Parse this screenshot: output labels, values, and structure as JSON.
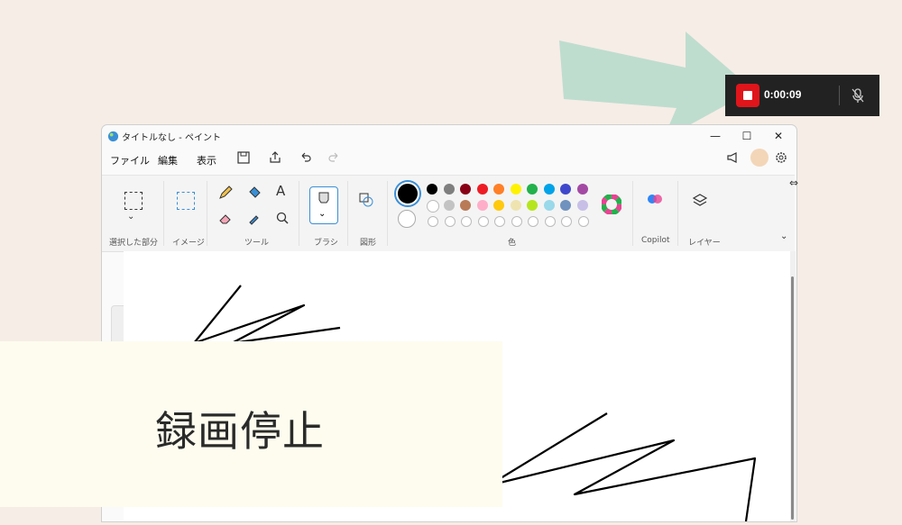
{
  "window": {
    "title": "タイトルなし - ペイント",
    "controls": {
      "minimize": "—",
      "maximize": "☐",
      "close": "✕"
    }
  },
  "menu": {
    "file": "ファイル",
    "edit": "編集",
    "view": "表示"
  },
  "ribbon": {
    "groups": {
      "selection": "選択した部分",
      "image": "イメージ",
      "tools": "ツール",
      "brush": "ブラシ",
      "shapes": "図形",
      "colors": "色",
      "copilot": "Copilot",
      "layers": "レイヤー"
    },
    "palette_row1": [
      "#000000",
      "#7f7f7f",
      "#880015",
      "#ed1c24",
      "#ff7f27",
      "#fff200",
      "#22b14c",
      "#00a2e8",
      "#3f48cc",
      "#a349a4"
    ],
    "palette_row2": [
      "#ffffff",
      "#c3c3c3",
      "#b97a57",
      "#ffaec9",
      "#ffc90e",
      "#efe4b0",
      "#b5e61d",
      "#99d9ea",
      "#7092be",
      "#c8bfe7"
    ]
  },
  "recording": {
    "time": "0:00:09"
  },
  "overlay": {
    "text": "録画停止"
  }
}
